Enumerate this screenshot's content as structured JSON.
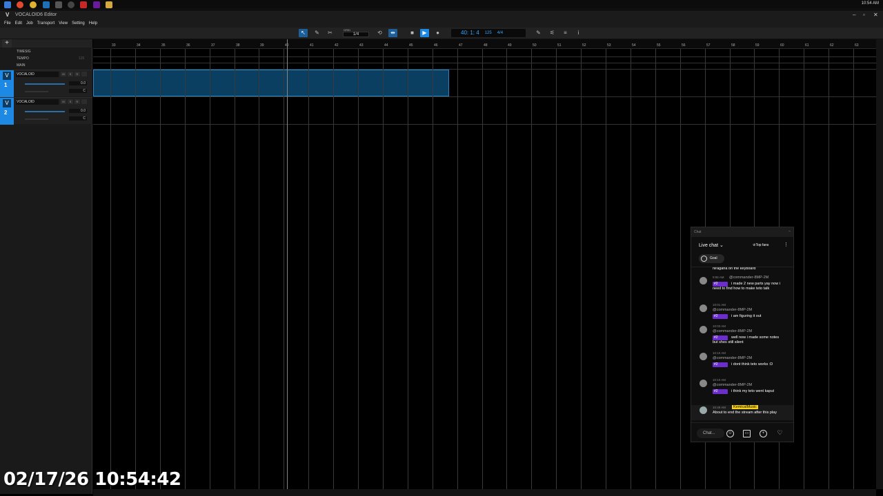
{
  "taskbar": {
    "clock": "10:54 AM"
  },
  "window": {
    "title": "VOCALOID6 Editor",
    "logo": "V",
    "minimize": "–",
    "maximize": "▫",
    "close": "✕"
  },
  "menu": [
    "File",
    "Edit",
    "Job",
    "Transport",
    "View",
    "Setting",
    "Help"
  ],
  "toolbar": {
    "grid_label": "GRID",
    "grid_value": "1/4",
    "time": "40: 1: 4",
    "tempo": "125",
    "signature": "4/4"
  },
  "header": {
    "add": "+",
    "lanes": [
      "TIMESIG",
      "TEMPO",
      "MAIN"
    ],
    "tempo_value": "125"
  },
  "tracks": [
    {
      "v": "V",
      "number": "1",
      "name": "VOCALOID",
      "m": "M",
      "s": "S",
      "r": "R",
      "vol": "0.0",
      "pan": "C"
    },
    {
      "v": "V",
      "number": "2",
      "name": "VOCALOID",
      "m": "M",
      "s": "S",
      "r": "R",
      "vol": "0.0",
      "pan": "C"
    }
  ],
  "ruler": [
    "33",
    "34",
    "35",
    "36",
    "37",
    "38",
    "39",
    "40",
    "41",
    "42",
    "43",
    "44",
    "45",
    "46",
    "47",
    "48",
    "49",
    "50",
    "51",
    "52",
    "53",
    "54",
    "55",
    "56",
    "57",
    "58",
    "59",
    "60",
    "61",
    "62",
    "63"
  ],
  "overlay": {
    "timestamp": "02/17/26 10:54:42"
  },
  "chat": {
    "window_title": "Chat",
    "close": "–",
    "title": "Live chat",
    "top_fans": "Top fans",
    "goal": "Goal",
    "messages": [
      {
        "time": "",
        "author": "",
        "badge": "",
        "text": "hiragana on the keyboard"
      },
      {
        "time": "9:55 AM",
        "author": "@commander-8MP-2M",
        "badge": "#2",
        "text": "i made 2 new parts yay now i need to find how to make teto talk"
      },
      {
        "time": "10:01 AM",
        "author": "@commander-8MP-2M",
        "badge": "#2",
        "text": "i am figuring it out"
      },
      {
        "time": "10:03 AM",
        "author": "@commander-8MP-2M",
        "badge": "#2",
        "text": "well now i made some notes but shes still silent"
      },
      {
        "time": "10:10 AM",
        "author": "@commander-8MP-2M",
        "badge": "#2",
        "text": "i dont think teto works :D"
      },
      {
        "time": "10:10 AM",
        "author": "@commander-8MP-2M",
        "badge": "#2",
        "text": "i think my teto went kaput"
      },
      {
        "time": "10:49 AM",
        "author": "KemicalMusic",
        "badge": "",
        "text": "About to end the stream after this play"
      }
    ],
    "input_placeholder": "Chat...",
    "colors": {
      "badge": "#6b2dcc",
      "owner_highlight": "#f7d21b",
      "accent": "#1e88e5"
    }
  }
}
